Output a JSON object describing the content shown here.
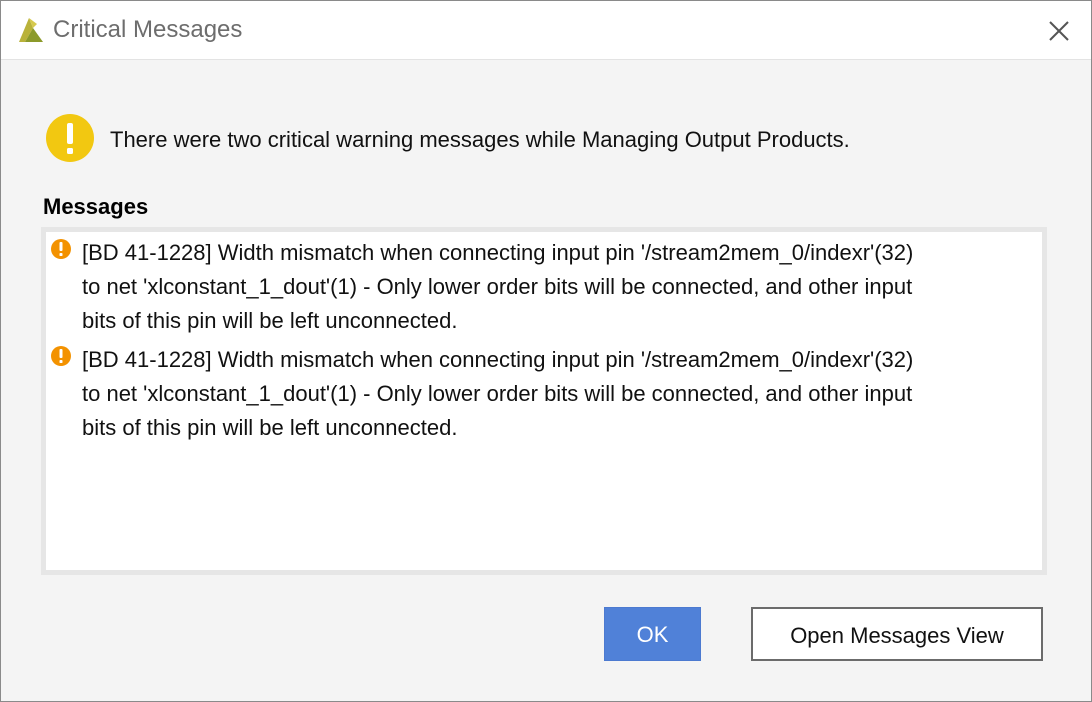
{
  "window": {
    "title": "Critical Messages",
    "logo_icon": "vivado-logo-icon",
    "close_icon": "close-icon"
  },
  "summary": {
    "icon": "warning-icon",
    "text": "There were two critical warning messages while Managing Output Products."
  },
  "messages": {
    "label": "Messages",
    "items": [
      {
        "severity": "critical-warning",
        "icon": "critical-warning-icon",
        "text": "[BD 41-1228] Width mismatch when connecting input pin '/stream2mem_0/indexr'(32)\nto net 'xlconstant_1_dout'(1) - Only lower order bits will be connected, and other input\nbits of this pin will be left unconnected."
      },
      {
        "severity": "critical-warning",
        "icon": "critical-warning-icon",
        "text": "[BD 41-1228] Width mismatch when connecting input pin '/stream2mem_0/indexr'(32)\nto net 'xlconstant_1_dout'(1) - Only lower order bits will be connected, and other input\nbits of this pin will be left unconnected."
      }
    ]
  },
  "buttons": {
    "ok_label": "OK",
    "open_messages_label": "Open Messages View"
  },
  "colors": {
    "primary_button": "#5081d8",
    "warning_yellow": "#f2c811",
    "critical_orange": "#f39200"
  }
}
